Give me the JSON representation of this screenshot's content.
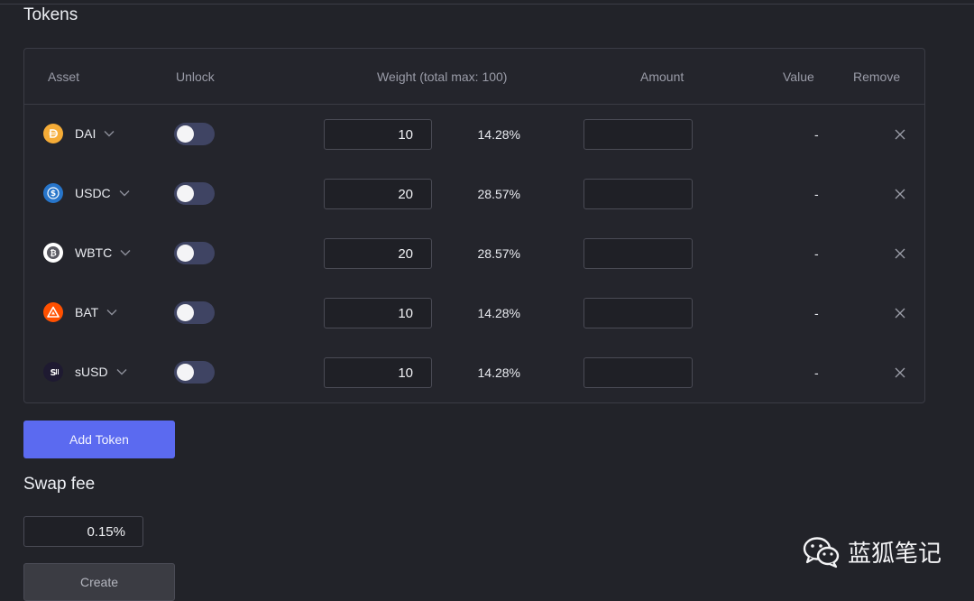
{
  "section_titles": {
    "tokens": "Tokens",
    "swap_fee": "Swap fee"
  },
  "table": {
    "headers": {
      "asset": "Asset",
      "unlock": "Unlock",
      "weight": "Weight (total max: 100)",
      "amount": "Amount",
      "value": "Value",
      "remove": "Remove"
    },
    "rows": [
      {
        "symbol": "DAI",
        "icon": "dai-coin-icon",
        "icon_color": "#f5ac37",
        "unlocked": false,
        "weight": "10",
        "percent": "14.28%",
        "amount": "",
        "value": "-"
      },
      {
        "symbol": "USDC",
        "icon": "usdc-coin-icon",
        "icon_color": "#2775ca",
        "unlocked": false,
        "weight": "20",
        "percent": "28.57%",
        "amount": "",
        "value": "-"
      },
      {
        "symbol": "WBTC",
        "icon": "wbtc-coin-icon",
        "icon_color": "#ffffff",
        "unlocked": false,
        "weight": "20",
        "percent": "28.57%",
        "amount": "",
        "value": "-"
      },
      {
        "symbol": "BAT",
        "icon": "bat-coin-icon",
        "icon_color": "#ff5000",
        "unlocked": false,
        "weight": "10",
        "percent": "14.28%",
        "amount": "",
        "value": "-"
      },
      {
        "symbol": "sUSD",
        "icon": "susd-coin-icon",
        "icon_color": "#1e1a31",
        "unlocked": false,
        "weight": "10",
        "percent": "14.28%",
        "amount": "",
        "value": "-"
      }
    ]
  },
  "buttons": {
    "add_token": "Add Token",
    "create": "Create"
  },
  "swap_fee": {
    "value": "0.15",
    "unit": "%"
  },
  "watermark": {
    "text": "蓝狐笔记",
    "icon": "wechat-icon"
  },
  "colors": {
    "accent": "#5b6af0",
    "background": "#222329",
    "toggle_off": "#3f4463"
  }
}
